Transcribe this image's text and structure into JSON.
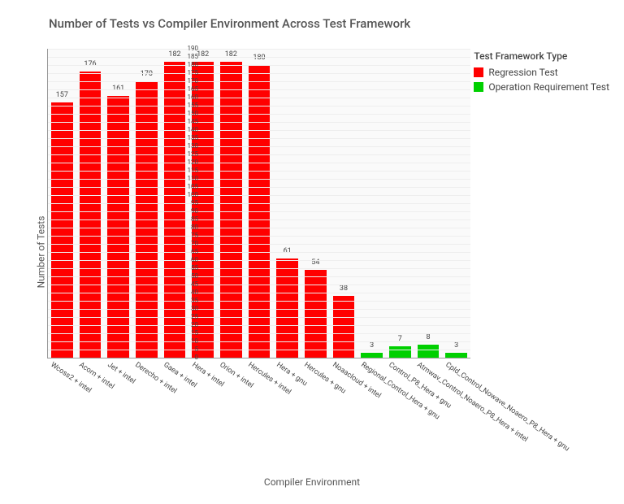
{
  "chart_data": {
    "type": "bar",
    "title": "Number of Tests vs Compiler Environment Across Test Framework",
    "xlabel": "Compiler Environment",
    "ylabel": "Number of Tests",
    "ylim": [
      0,
      190
    ],
    "ystep": 5,
    "legend_title": "Test Framework Type",
    "series_meta": [
      {
        "name": "Regression Test",
        "color": "#ff0000"
      },
      {
        "name": "Operation Requirement Test",
        "color": "#00d000"
      }
    ],
    "categories": [
      "Wcoss2 + intel",
      "Acorn + intel",
      "Jet + intel",
      "Derecho + intel",
      "Gaea + intel",
      "Hera + intel",
      "Orion + intel",
      "Hercules + intel",
      "Hera + gnu",
      "Hercules + gnu",
      "Noaacloud + intel",
      "Regional_Control_Hera + gnu",
      "Control_P8_Hera + gnu",
      "Atmwav_Control_Noaero_P8_Hera + intel",
      "Cpld_Control_Nowave_Noaero_P8_Hera + gnu"
    ],
    "values": [
      157,
      176,
      161,
      170,
      182,
      182,
      182,
      180,
      61,
      54,
      38,
      3,
      7,
      8,
      3
    ],
    "colors": [
      "#ff0000",
      "#ff0000",
      "#ff0000",
      "#ff0000",
      "#ff0000",
      "#ff0000",
      "#ff0000",
      "#ff0000",
      "#ff0000",
      "#ff0000",
      "#ff0000",
      "#00d000",
      "#00d000",
      "#00d000",
      "#00d000"
    ]
  }
}
